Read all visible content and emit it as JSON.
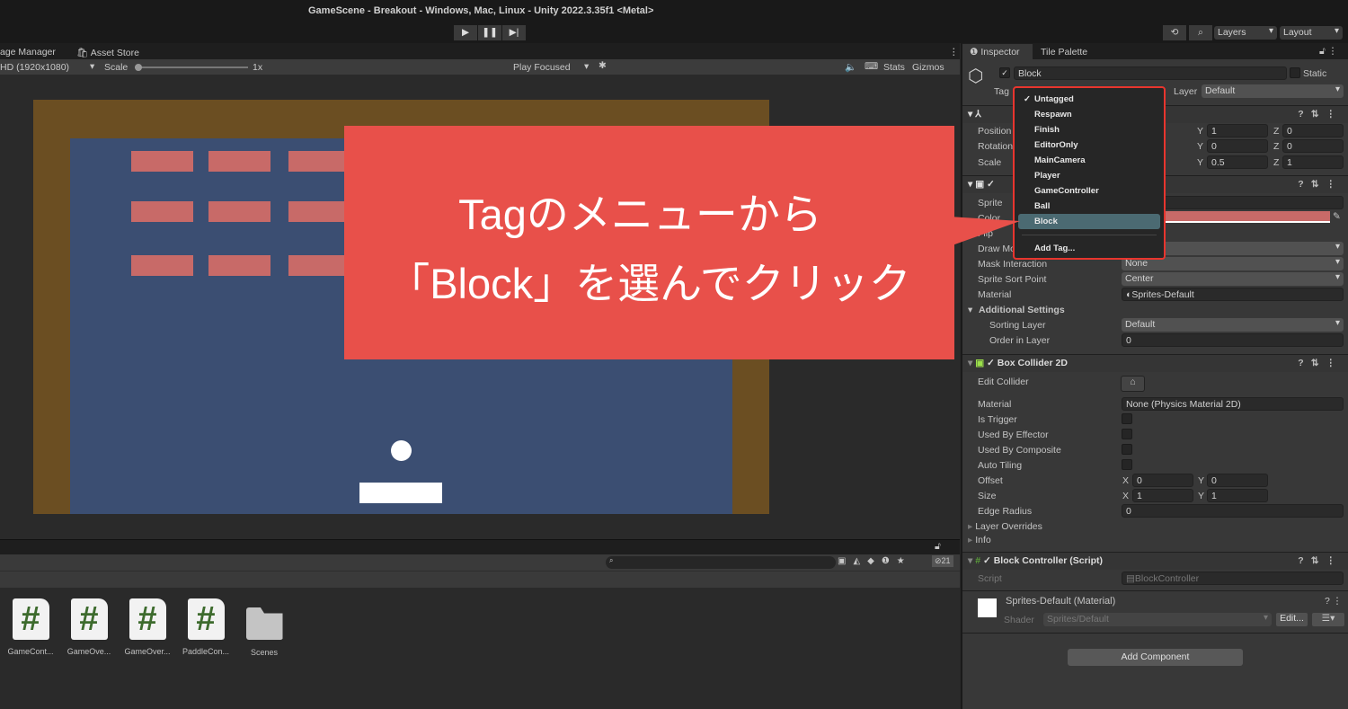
{
  "window": {
    "title": "GameScene - Breakout - Windows, Mac, Linux - Unity 2022.3.35f1 <Metal>"
  },
  "toolbar": {
    "layers": "Layers",
    "layout": "Layout",
    "play_icon": "play-icon",
    "pause_icon": "pause-icon",
    "step_icon": "step-icon"
  },
  "tabs": {
    "package_manager": "age Manager",
    "asset_store": "Asset Store"
  },
  "game_toolbar": {
    "resolution": "HD (1920x1080)",
    "scale_label": "Scale",
    "scale_value": "1x",
    "play_mode": "Play Focused",
    "stats": "Stats",
    "gizmos": "Gizmos"
  },
  "game_colors": {
    "border": "#6b4e22",
    "field": "#3b4e72",
    "brick": "#c86a68",
    "ball": "#ffffff",
    "paddle": "#ffffff"
  },
  "callout": {
    "line1": "Tagのメニューから",
    "line2": "「Block」を選んでクリック",
    "color": "#e8504a"
  },
  "inspector": {
    "tabs": [
      "Inspector",
      "Tile Palette"
    ],
    "object_name": "Block",
    "static_label": "Static",
    "tag_label": "Tag",
    "layer_label": "Layer",
    "layer_value": "Default",
    "transform": {
      "rows": [
        {
          "label": "Position",
          "y": "1",
          "z": "0"
        },
        {
          "label": "Rotation",
          "y": "0",
          "z": "0"
        },
        {
          "label": "Scale",
          "y": "0.5",
          "z": "1"
        }
      ]
    },
    "sprite_renderer": {
      "sprite": "Sprite",
      "color": "Color",
      "color_value": "#c86a68",
      "flip": "Flip",
      "draw_mode": "Draw Mode",
      "mask_label": "Mask Interaction",
      "mask_value": "None",
      "sort_label": "Sprite Sort Point",
      "sort_value": "Center",
      "material_label": "Material",
      "material_value": "Sprites-Default",
      "additional": "Additional Settings",
      "sorting_layer_label": "Sorting Layer",
      "sorting_layer_value": "Default",
      "order_label": "Order in Layer",
      "order_value": "0"
    },
    "box_collider": {
      "title": "Box Collider 2D",
      "edit_collider": "Edit Collider",
      "material_label": "Material",
      "material_value": "None (Physics Material 2D)",
      "is_trigger": "Is Trigger",
      "used_by_effector": "Used By Effector",
      "used_by_composite": "Used By Composite",
      "auto_tiling": "Auto Tiling",
      "offset_label": "Offset",
      "offset_x": "0",
      "offset_y": "0",
      "size_label": "Size",
      "size_x": "1",
      "size_y": "1",
      "edge_radius_label": "Edge Radius",
      "edge_radius_value": "0",
      "layer_overrides": "Layer Overrides",
      "info": "Info"
    },
    "script": {
      "title": "Block Controller (Script)",
      "script_label": "Script",
      "script_value": "BlockController"
    },
    "material": {
      "title": "Sprites-Default (Material)",
      "shader_label": "Shader",
      "shader_value": "Sprites/Default",
      "edit": "Edit..."
    },
    "add_component": "Add Component"
  },
  "tag_menu": {
    "selected": "Untagged",
    "items": [
      "Untagged",
      "Respawn",
      "Finish",
      "EditorOnly",
      "MainCamera",
      "Player",
      "GameController",
      "Ball",
      "Block"
    ],
    "highlighted": "Block",
    "add_tag": "Add Tag..."
  },
  "project": {
    "hidden_count": "21",
    "assets": [
      "GameCont...",
      "GameOve...",
      "GameOver...",
      "PaddleCon...",
      "Scenes"
    ]
  }
}
